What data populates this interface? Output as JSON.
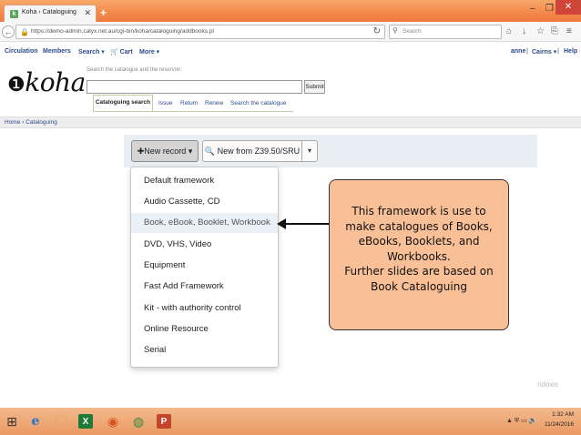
{
  "browser": {
    "tab_favicon": "k",
    "tab_title": "Koha › Cataloguing",
    "tab_close": "✕",
    "new_tab": "+",
    "min": "–",
    "max": "❐",
    "close": "✕",
    "url": "https://demo-admin.calyx.net.au/cgi-bin/koha/cataloguing/addbooks.pl",
    "search_placeholder": "Search",
    "nav_back": "←",
    "lock": "🔒",
    "reload": "↻",
    "search_glyph": "⚲",
    "toolbar_icons": {
      "home": "⌂",
      "download": "↓",
      "bookmark": "☆",
      "library": "⎘",
      "menu": "≡"
    }
  },
  "koha_menu": {
    "circulation": "Circulation",
    "members": "Members",
    "search": "Search ▾",
    "cart": "🛒 Cart",
    "more": "More ▾",
    "user": "anne",
    "sep1": "|",
    "branch": "Cairns ▾",
    "sep2": "|",
    "help": "Help"
  },
  "logo": {
    "text": "koha",
    "mark": "❶"
  },
  "search": {
    "hint": "Search the catalogue and the reservoir:",
    "submit": "Submit",
    "tabs": {
      "active": "Cataloguing search",
      "issue": "Issue",
      "return": "Return",
      "renew": "Renew",
      "search_catalogue": "Search the catalogue"
    }
  },
  "breadcrumb": "Home › Cataloguing",
  "toolbar": {
    "new_record": "✚New record ▾",
    "new_z3950": "🔍 New from Z39.50/SRU",
    "caret": "▾"
  },
  "dropdown": {
    "items": [
      "Default framework",
      "Audio Cassette, CD",
      "Book, eBook, Booklet, Workbook",
      "DVD, VHS, Video",
      "Equipment",
      "Fast Add Framework",
      "Kit - with authority control",
      "Online Resource",
      "Serial"
    ]
  },
  "callout": {
    "lines": [
      "This framework is use to",
      "make catalogues of Books,",
      "eBooks, Booklets, and",
      "Workbooks.",
      "Further slides are based on",
      "Book Cataloguing"
    ]
  },
  "watermark": "ndows",
  "taskbar": {
    "start": "⊞",
    "ie": "e",
    "explorer": "🗀",
    "excel": "X",
    "firefox": "◉",
    "chrome": "◍",
    "ppt": "P",
    "tray": "▲ ⛨ ▭ 🔊",
    "time": "1:32 AM",
    "date": "11/24/2016"
  },
  "colors": {
    "callout_bg": "#f9bf96",
    "taskbar": "#ea9a64",
    "link": "#2b4a8a",
    "highlight_row": "#e9f0f6"
  }
}
